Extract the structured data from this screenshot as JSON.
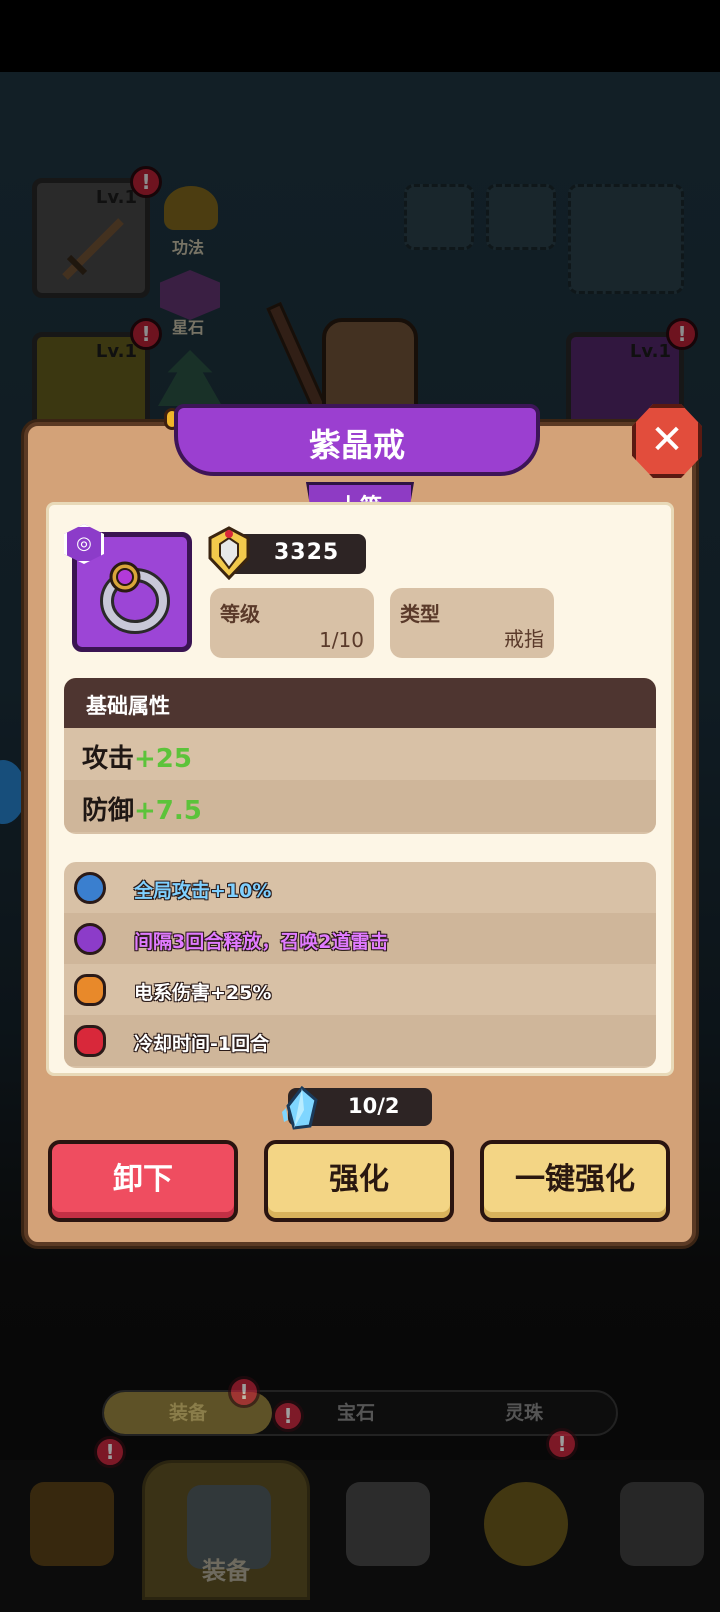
{
  "scene": {
    "weapon_level": "Lv.1",
    "ring_left_level": "Lv.1",
    "ring_right_level": "Lv.1",
    "alert_mark": "!",
    "label_kungfu": "功法",
    "label_starstone": "星石"
  },
  "modal": {
    "title": "紫晶戒",
    "grade": "上等",
    "close_glyph": "✕",
    "power": "3325",
    "level_label": "等级",
    "level_value": "1/10",
    "type_label": "类型",
    "type_value": "戒指",
    "base_title": "基础属性",
    "stats": [
      {
        "name": "攻击",
        "value": "+25"
      },
      {
        "name": "防御",
        "value": "+7.5"
      }
    ],
    "skills": [
      {
        "text": "全局攻击+10%",
        "color": "#3a7fcf",
        "text_color": "#7fd0ff"
      },
      {
        "text": "间隔3回合释放，召唤2道雷击",
        "color": "#8c3cc9",
        "text_color": "#e07bff"
      },
      {
        "text": "电系伤害+25%",
        "color": "#e8892a",
        "text_color": "#ffffff"
      },
      {
        "text": "冷却时间-1回合",
        "color": "#d8283a",
        "text_color": "#ffffff"
      }
    ],
    "material": "10/2",
    "buttons": {
      "unequip": "卸下",
      "enhance": "强化",
      "enhance_all": "一键强化"
    }
  },
  "bottom_tabs": [
    "装备",
    "宝石",
    "灵珠"
  ],
  "nav": {
    "active_label": "装备"
  },
  "colors": {
    "rarity_purple": "#9c45d6",
    "stat_green": "#5cc33a",
    "button_red": "#ef4d60",
    "button_yellow": "#f3d585"
  }
}
